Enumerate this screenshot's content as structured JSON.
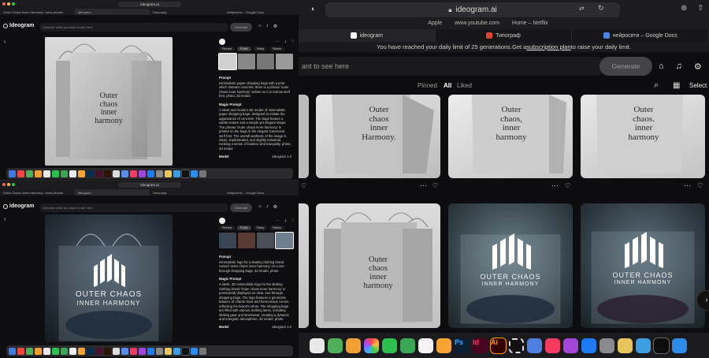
{
  "right_browser": {
    "url": "ideogram.ai",
    "favorites": [
      "Apple",
      "www.youtube.com",
      "Home – Netflix"
    ],
    "tabs": [
      {
        "label": "ideogram",
        "active": true,
        "favicon_color": "#ffffff"
      },
      {
        "label": "Типограф",
        "active": false,
        "favicon_color": "#e0452b"
      },
      {
        "label": "нейросети – Google Docs",
        "active": false,
        "favicon_color": "#4a86e8"
      }
    ],
    "banner": {
      "text_before": "You have reached your daily limit of 25 generations.Get a ",
      "link": "subscription plan",
      "text_after": " to raise your daily limit."
    },
    "prompt_placeholder": "ant to see here",
    "generate_label": "Generate",
    "filter_tabs": [
      "Pinned",
      "All",
      "Liked"
    ],
    "select_label": "Select",
    "grid": {
      "row1_texts": [
        "Outer\nchaos\ninner\nHarmony.",
        "Outer\nchaos,\ninner\nharmony",
        "Outer\nchaos.\ninner\nharmony"
      ],
      "row2_left_text": "Outer\nchaos\ninner\nharmony",
      "logo_text_line1": "OUTER CHAOS",
      "logo_text_line2": "INNER HARMONY"
    }
  },
  "left_top": {
    "url": "ideogram.ai",
    "tabs": [
      "Outer Chaos Inner Harmony / stock photos",
      "Ideogram",
      "Типограф",
      "нейросети – Google Docs"
    ],
    "favorites": [
      "Apple",
      "www.youtube.com",
      "Home – Netflix"
    ],
    "logo": "Ideogram",
    "search_placeholder": "Describe what you want to see here",
    "generate_label": "Generate",
    "bag_text": "Outer\nchaos\ninner\nharmony",
    "side_tabs": [
      "Pinned",
      "Public",
      "Retry",
      "Remix"
    ],
    "prompt_label": "Prompt",
    "prompt_text": "minimalistic paper shopping bags with a print which imitates concrete, there is a phrase 'outer chaos inner harmony' written on it in narrow serif font, photo, 3d render",
    "magic_label": "Magic Prompt",
    "magic_text": "A sleek and modern 3D render of minimalistic paper shopping bags, designed to imitate the appearance of concrete. The bags feature a subtle texture and a simple yet elegant shape. The phrase 'Outer chaos inner harmony' is printed on the bags in the elegant Garamond serif font. The overall aesthetic of the image is clean, sophisticated, and slightly industrial, evoking a sense of balance and tranquility. photo, 3d render",
    "model_label": "Model",
    "model_value": "Ideogram 1.0"
  },
  "left_bottom": {
    "url": "ideogram.ai",
    "tabs": [
      "Outer Chaos Inner Harmony / stock photos",
      "Ideogram",
      "Типограф",
      "нейросети – Google Docs"
    ],
    "logo": "Ideogram",
    "search_placeholder": "Describe what you want to see here",
    "generate_label": "Generate",
    "logo_line1": "OUTER CHAOS",
    "logo_line2": "INNER HARMONY",
    "side_tabs": [
      "Pinned",
      "Public",
      "Retry",
      "Remix"
    ],
    "prompt_label": "Prompt",
    "prompt_text": "minimalistic logo for a skating clothing brand named 'outer chaos inner harmony' on a see-through shopping bags, 3d render, photo",
    "magic_label": "Magic Prompt",
    "magic_text": "A sleek, 3D minimalistic logo for the skating clothing brand 'Outer chaos inner harmony' is prominently displayed on clear, see-through shopping bags. The logo features a geometric balance of chaotic lines and harmonious curves, reflecting the brand's ethos. The shopping bags are filled with various clothing items, including skating gear and streetwear, creating a dynamic and energetic atmosphere. 3d render, photo",
    "model_label": "Model",
    "model_value": "Ideogram 1.0"
  },
  "colors": {
    "background": "#0d0d0f",
    "chrome": "#1c1c1e",
    "accent_red": "#e0452b",
    "accent_blue": "#4a86e8"
  },
  "icons": {
    "home": "home-icon",
    "bell": "bell-icon",
    "settings": "settings-icon",
    "search": "search-icon",
    "grid": "grid-view-icon"
  }
}
